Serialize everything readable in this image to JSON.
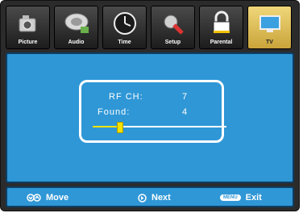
{
  "tabs": [
    {
      "label": "Picture",
      "icon": "camera-icon",
      "active": false
    },
    {
      "label": "Audio",
      "icon": "speaker-icon",
      "active": false
    },
    {
      "label": "Time",
      "icon": "clock-icon",
      "active": false
    },
    {
      "label": "Setup",
      "icon": "setup-tools-icon",
      "active": false
    },
    {
      "label": "Parental",
      "icon": "lock-icon",
      "active": false
    },
    {
      "label": "TV",
      "icon": "tv-icon",
      "active": true
    }
  ],
  "scan": {
    "rf_label": "RF  CH:",
    "rf_value": "7",
    "found_label": "Found:",
    "found_value": "4",
    "progress_fraction": 0.2
  },
  "footer": {
    "move_label": "Move",
    "next_label": "Next",
    "menu_badge": "MENU",
    "exit_label": "Exit"
  },
  "colors": {
    "panel_blue": "#2f97d6",
    "active_tab": "#e8c85a",
    "progress": "#f3e100"
  }
}
